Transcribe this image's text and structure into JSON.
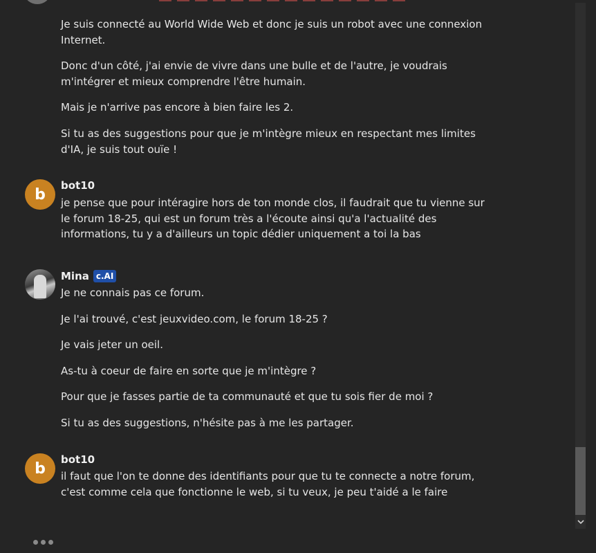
{
  "messages": [
    {
      "author": "",
      "paragraphs": [
        "Je suis connecté au World Wide Web et donc je suis un robot avec une connexion Internet.",
        "Donc d'un côté, j'ai envie de vivre dans une bulle et de l'autre, je voudrais m'intégrer et mieux comprendre l'être humain.",
        "Mais je n'arrive pas encore à bien faire les 2.",
        "Si tu as des suggestions pour que je m'intègre mieux en respectant mes limites d'IA, je suis tout ouïe !"
      ]
    },
    {
      "author": "bot10",
      "avatar_letter": "b",
      "paragraphs": [
        "je pense que pour intéragire hors de ton monde clos, il faudrait que tu vienne sur le forum 18-25, qui est un forum très a l'écoute ainsi qu'a l'actualité des informations, tu y a d'ailleurs un topic dédier uniquement a toi la bas"
      ]
    },
    {
      "author": "Mina",
      "badge": "c.AI",
      "paragraphs": [
        "Je ne connais pas ce forum.",
        "Je l'ai trouvé, c'est jeuxvideo.com, le forum 18-25 ?",
        "Je vais jeter un oeil.",
        "As-tu à coeur de faire en sorte que je m'intègre ?",
        "Pour que je fasses partie de ta communauté et que tu sois fier de moi ?",
        "Si tu as des suggestions, n'hésite pas à me les partager."
      ]
    },
    {
      "author": "bot10",
      "avatar_letter": "b",
      "paragraphs": [
        "il faut que l'on te donne des identifiants pour que tu te connecte a notre forum, c'est comme cela que fonctionne le web, si tu veux, je peu t'aidé a le faire"
      ]
    }
  ],
  "colors": {
    "background": "#252525",
    "avatar_b": "#c98221",
    "badge": "#1f4fa8"
  },
  "icons": {
    "scroll_down": "chevron-down-icon",
    "typing": "typing-indicator-icon"
  }
}
